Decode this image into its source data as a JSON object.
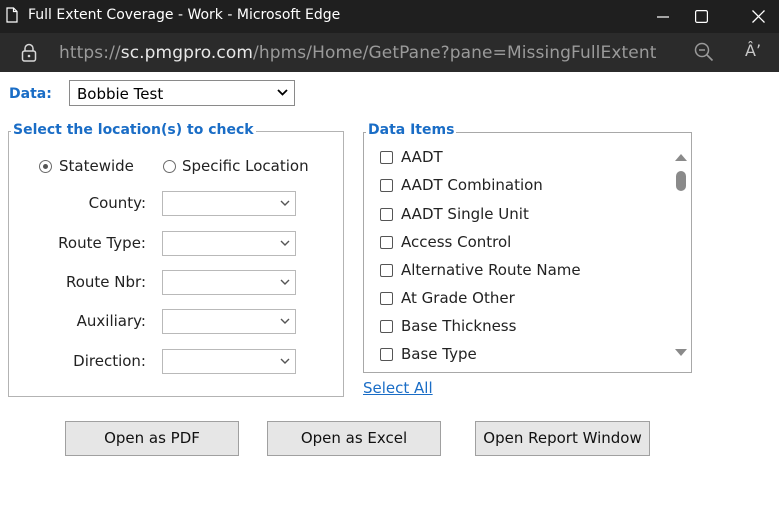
{
  "window": {
    "title": "Full Extent Coverage - Work - Microsoft Edge",
    "url_protocol": "https://",
    "url_host": "sc.pmgpro.com",
    "url_path": "/hpms/Home/GetPane?pane=MissingFullExtent",
    "read_aloud_glyph": "Â’",
    "icons": [
      "document-icon",
      "minimize-icon",
      "maximize-icon",
      "close-icon",
      "lock-icon",
      "zoom-icon",
      "read-aloud-icon"
    ]
  },
  "data_select": {
    "label": "Data:",
    "value": "Bobbie Test"
  },
  "location": {
    "legend": "Select the location(s) to check",
    "statewide_label": "Statewide",
    "specific_label": "Specific Location",
    "selected": "Statewide",
    "fields": [
      {
        "label": "County:",
        "value": ""
      },
      {
        "label": "Route Type:",
        "value": ""
      },
      {
        "label": "Route Nbr:",
        "value": ""
      },
      {
        "label": "Auxiliary:",
        "value": ""
      },
      {
        "label": "Direction:",
        "value": ""
      }
    ]
  },
  "data_items": {
    "legend": "Data Items",
    "items": [
      {
        "label": "AADT",
        "checked": false
      },
      {
        "label": "AADT Combination",
        "checked": false
      },
      {
        "label": "AADT Single Unit",
        "checked": false
      },
      {
        "label": "Access Control",
        "checked": false
      },
      {
        "label": "Alternative Route Name",
        "checked": false
      },
      {
        "label": "At Grade Other",
        "checked": false
      },
      {
        "label": "Base Thickness",
        "checked": false
      },
      {
        "label": "Base Type",
        "checked": false
      }
    ],
    "select_all_label": "Select All"
  },
  "buttons": {
    "pdf": "Open as PDF",
    "excel": "Open as Excel",
    "report": "Open Report Window"
  },
  "colors": {
    "accent": "#1a6dc6",
    "titlebar": "#1f1f1f",
    "addressbar": "#2b2b2b"
  }
}
